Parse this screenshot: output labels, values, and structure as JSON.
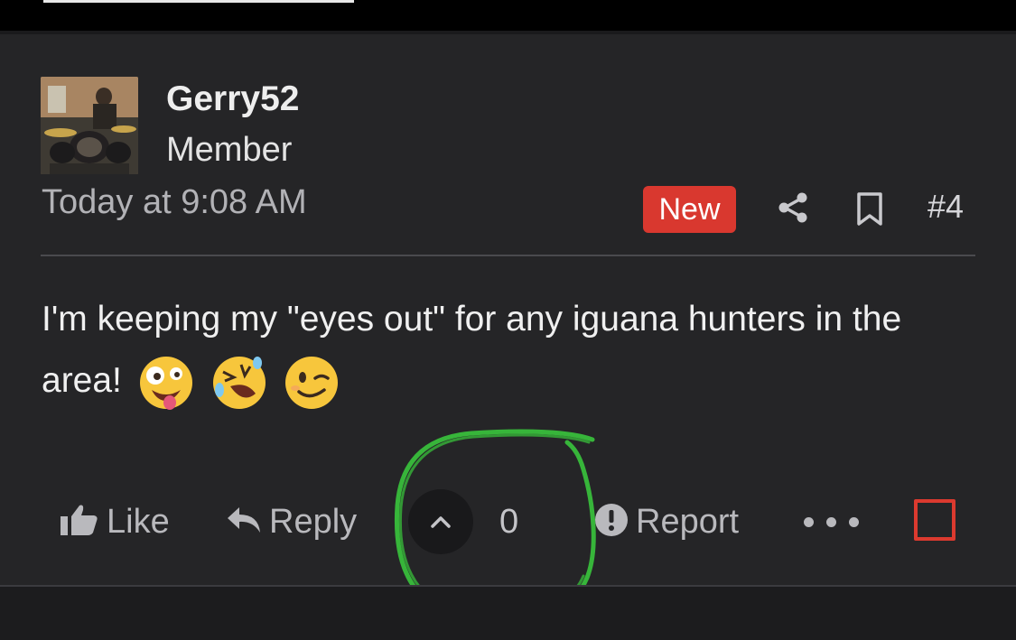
{
  "post": {
    "username": "Gerry52",
    "role": "Member",
    "timestamp": "Today at 9:08 AM",
    "badge": "New",
    "post_number": "#4",
    "body": "I'm keeping my \"eyes out\" for any iguana hunters in the area!",
    "emojis": [
      "zany-face",
      "rolling-on-floor-laughing",
      "winking-face"
    ],
    "avatar": "avatar-photo-drummer"
  },
  "actions": {
    "like_label": "Like",
    "reply_label": "Reply",
    "vote_count": "0",
    "report_label": "Report"
  },
  "icons": {
    "like": "thumbs-up-icon",
    "reply": "reply-arrow-icon",
    "upvote": "chevron-up-icon",
    "report": "exclamation-circle-icon",
    "share": "share-icon",
    "bookmark": "bookmark-icon",
    "more": "more-dots-icon"
  },
  "colors": {
    "background": "#252527",
    "badge": "#d9382f",
    "annotation": "#37b53a",
    "checkbox": "#dc3a2f"
  }
}
